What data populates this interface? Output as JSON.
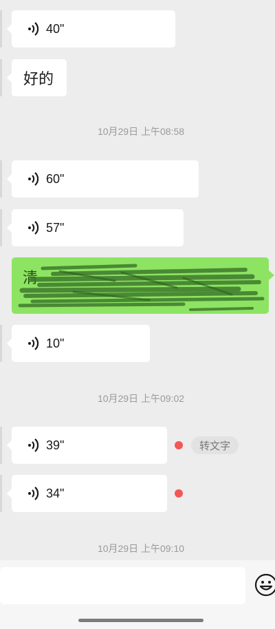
{
  "timestamps": [
    "10月29日 上午08:58",
    "10月29日 上午09:02",
    "10月29日 上午09:10"
  ],
  "messages": {
    "m1": {
      "type": "voice",
      "duration": "40\""
    },
    "m2": {
      "type": "text",
      "text": "好的"
    },
    "m3": {
      "type": "voice",
      "duration": "60\""
    },
    "m4": {
      "type": "voice",
      "duration": "57\""
    },
    "m5": {
      "type": "text-outgoing-redacted",
      "visible_text": "清"
    },
    "m6": {
      "type": "voice",
      "duration": "10\""
    },
    "m7": {
      "type": "voice",
      "duration": "39\"",
      "unread": true
    },
    "m8": {
      "type": "voice",
      "duration": "34\"",
      "unread": true
    }
  },
  "convert_to_text_label": "转文字",
  "icons": {
    "voice": "voice-wave-icon",
    "emoji": "emoji-icon"
  },
  "colors": {
    "background": "#ededed",
    "incoming_bubble": "#ffffff",
    "outgoing_bubble": "#8de463",
    "unread_dot": "#f25656"
  }
}
